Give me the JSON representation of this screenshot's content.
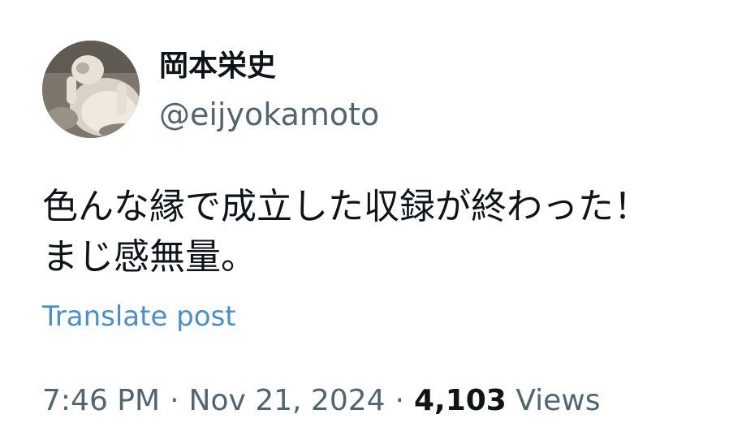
{
  "author": {
    "display_name": "岡本栄史",
    "handle": "@eijyokamoto",
    "avatar": "avatar-photo-cat"
  },
  "post": {
    "lines": [
      "色んな縁で成立した収録が終わった！",
      "まじ感無量。"
    ],
    "translate_label": "Translate post"
  },
  "meta": {
    "time": "7:46 PM",
    "separator": "·",
    "date": "Nov 21, 2024",
    "views_count": "4,103",
    "views_label": "Views"
  },
  "colors": {
    "text_primary": "#0f1419",
    "text_secondary": "#536471",
    "link": "#4a90c6"
  }
}
